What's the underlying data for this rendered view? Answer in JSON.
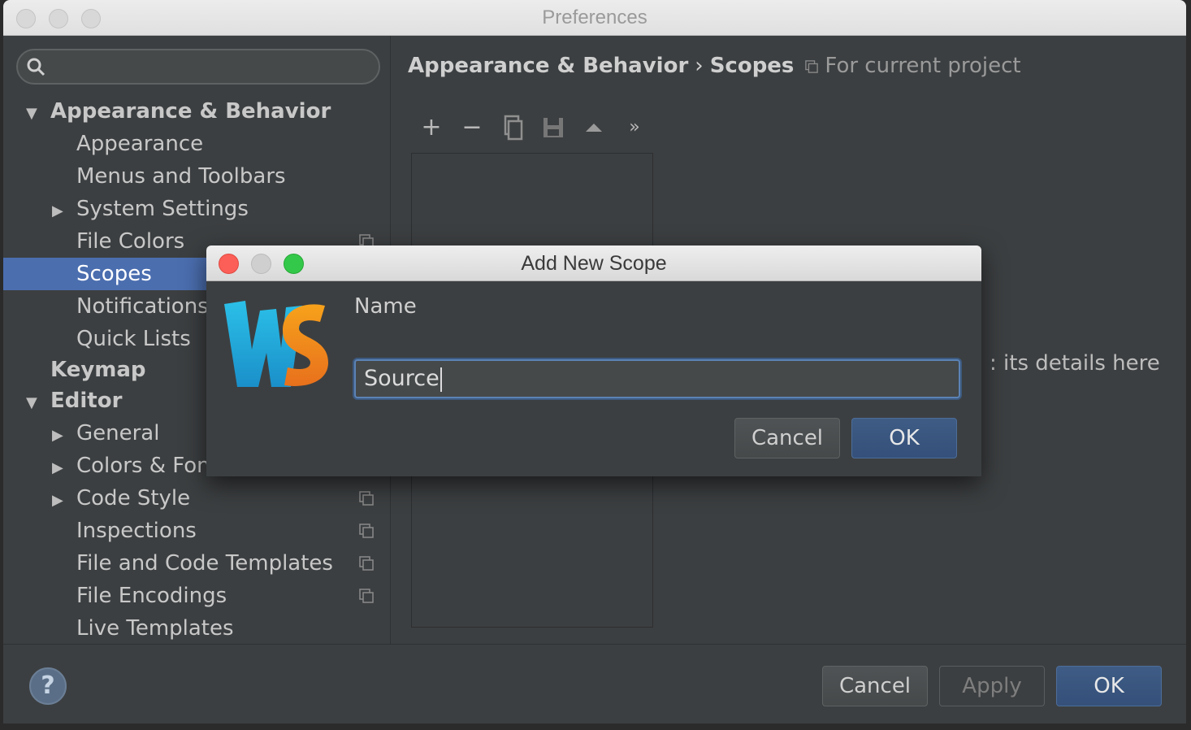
{
  "window": {
    "title": "Preferences"
  },
  "sidebar": {
    "items": [
      {
        "label": "Appearance & Behavior",
        "expanded": true,
        "level": 0
      },
      {
        "label": "Appearance",
        "level": 1
      },
      {
        "label": "Menus and Toolbars",
        "level": 1
      },
      {
        "label": "System Settings",
        "level": 1,
        "collapsed": true
      },
      {
        "label": "File Colors",
        "level": 1,
        "project_icon": true
      },
      {
        "label": "Scopes",
        "level": 1,
        "selected": true
      },
      {
        "label": "Notifications",
        "level": 1
      },
      {
        "label": "Quick Lists",
        "level": 1
      },
      {
        "label": "Keymap",
        "level": 0
      },
      {
        "label": "Editor",
        "expanded": true,
        "level": 0
      },
      {
        "label": "General",
        "level": 1,
        "collapsed": true
      },
      {
        "label": "Colors & Fon",
        "level": 1,
        "collapsed": true
      },
      {
        "label": "Code Style",
        "level": 1,
        "collapsed": true,
        "project_icon": true
      },
      {
        "label": "Inspections",
        "level": 1,
        "project_icon": true
      },
      {
        "label": "File and Code Templates",
        "level": 1,
        "project_icon": true
      },
      {
        "label": "File Encodings",
        "level": 1,
        "project_icon": true
      },
      {
        "label": "Live Templates",
        "level": 1
      }
    ]
  },
  "panel": {
    "breadcrumb_parent": "Appearance & Behavior",
    "breadcrumb_sep": "›",
    "breadcrumb_current": "Scopes",
    "scope_note": "For current project",
    "hint_text": ": its details here",
    "toolbar": [
      "add-icon",
      "remove-icon",
      "copy-icon",
      "save-icon",
      "move-up-icon",
      "more-icon"
    ]
  },
  "footer": {
    "help_label": "?",
    "cancel_label": "Cancel",
    "apply_label": "Apply",
    "ok_label": "OK"
  },
  "dialog": {
    "title": "Add New Scope",
    "name_label": "Name",
    "name_value": "Source",
    "cancel_label": "Cancel",
    "ok_label": "OK"
  },
  "colors": {
    "selection": "#4b6eaf",
    "background": "#3c3f41",
    "primary_button": "#35507a"
  }
}
